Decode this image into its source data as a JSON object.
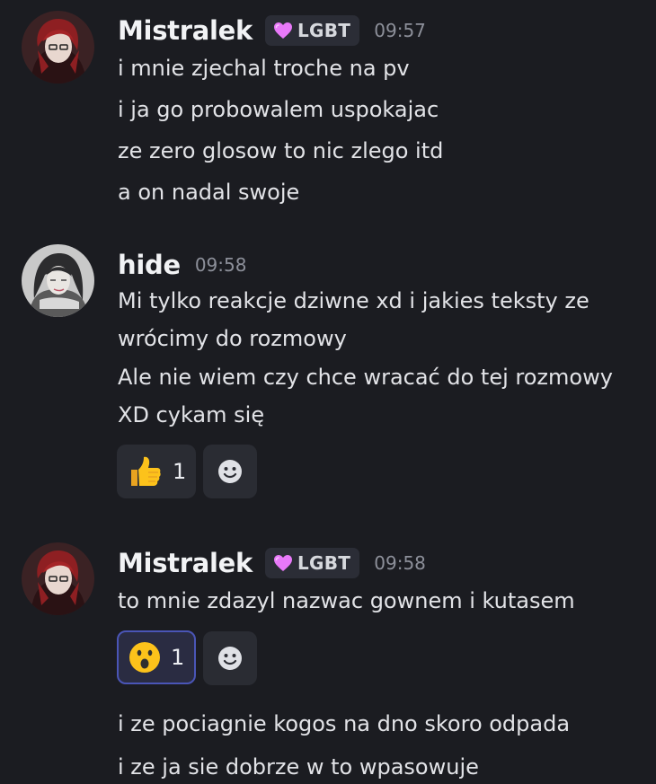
{
  "messages": [
    {
      "author": "Mistralek",
      "tag": "LGBT",
      "time": "09:57",
      "lines": [
        "i mnie zjechal troche na pv",
        "i ja go probowalem uspokajac",
        "ze zero glosow to nic zlego itd",
        "a on nadal swoje"
      ]
    },
    {
      "author": "hide",
      "time": "09:58",
      "lines": [
        "Mi tylko reakcje dziwne xd i jakies teksty ze",
        "wrócimy do rozmowy",
        "Ale nie wiem czy chce wracać do tej rozmowy",
        "XD cykam się"
      ],
      "reactions": [
        {
          "emoji": "thumbs-up",
          "count": "1"
        }
      ]
    },
    {
      "author": "Mistralek",
      "tag": "LGBT",
      "time": "09:58",
      "lines": [
        "to mnie zdazyl nazwac gownem i kutasem"
      ],
      "reactions": [
        {
          "emoji": "surprised-face",
          "count": "1"
        }
      ],
      "followup_lines": [
        "i ze pociagnie kogos na dno skoro odpada",
        "i ze ja sie dobrze w to wpasowuje"
      ]
    }
  ],
  "colors": {
    "background": "#1b1c21",
    "tag_heart": "#e879f9",
    "reaction_active_border": "#4a55b6"
  },
  "icons": {
    "add_reaction": "smiley-face-icon",
    "tag": "purple-heart-icon"
  }
}
